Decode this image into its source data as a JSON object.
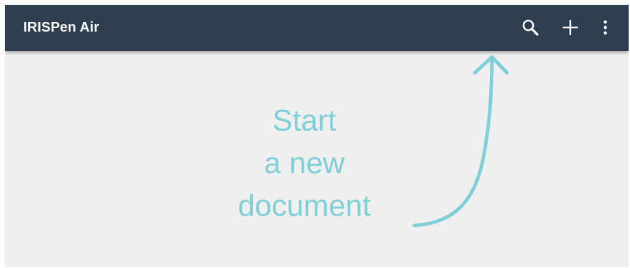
{
  "appbar": {
    "title": "IRISPen Air",
    "background_color": "#2c3e4f",
    "actions": {
      "search": {
        "icon": "search-icon"
      },
      "add": {
        "icon": "plus-icon"
      },
      "more": {
        "icon": "more-vert-icon"
      }
    }
  },
  "empty_state": {
    "lines": [
      "Start",
      "a new",
      "document"
    ],
    "text_color": "#7fcfd8",
    "arrow_icon": "curved-arrow-up-icon"
  },
  "content_background_color": "#efefef"
}
